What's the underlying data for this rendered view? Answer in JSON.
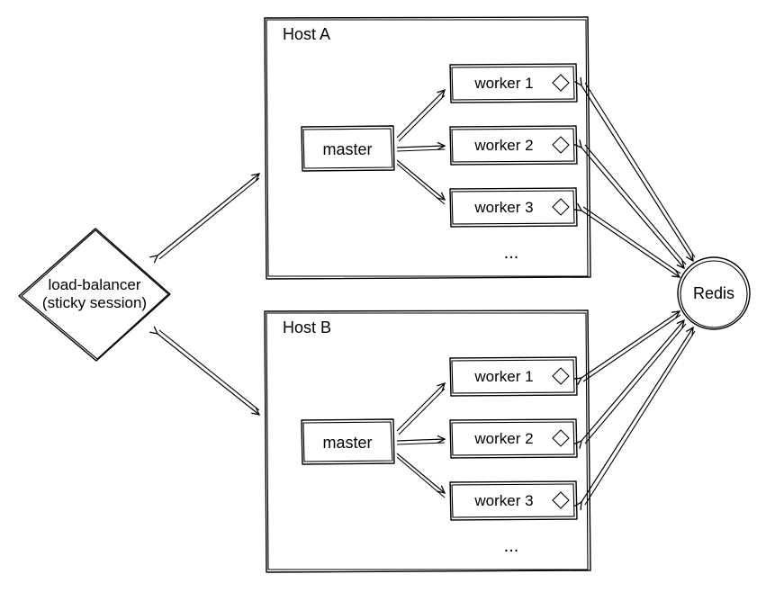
{
  "lb": {
    "line1": "load-balancer",
    "line2": "(sticky session)"
  },
  "hostA": {
    "title": "Host A",
    "master": "master",
    "workers": [
      "worker 1",
      "worker 2",
      "worker 3"
    ],
    "ellipsis": "..."
  },
  "hostB": {
    "title": "Host B",
    "master": "master",
    "workers": [
      "worker 1",
      "worker 2",
      "worker 3"
    ],
    "ellipsis": "..."
  },
  "redis": "Redis",
  "chart_data": {
    "type": "diagram",
    "title": "",
    "nodes": [
      {
        "id": "lb",
        "label": "load-balancer (sticky session)",
        "shape": "diamond"
      },
      {
        "id": "hostA",
        "label": "Host A",
        "shape": "container",
        "children": [
          {
            "id": "masterA",
            "label": "master",
            "shape": "box"
          },
          {
            "id": "wA1",
            "label": "worker 1",
            "shape": "box"
          },
          {
            "id": "wA2",
            "label": "worker 2",
            "shape": "box"
          },
          {
            "id": "wA3",
            "label": "worker 3",
            "shape": "box"
          }
        ]
      },
      {
        "id": "hostB",
        "label": "Host B",
        "shape": "container",
        "children": [
          {
            "id": "masterB",
            "label": "master",
            "shape": "box"
          },
          {
            "id": "wB1",
            "label": "worker 1",
            "shape": "box"
          },
          {
            "id": "wB2",
            "label": "worker 2",
            "shape": "box"
          },
          {
            "id": "wB3",
            "label": "worker 3",
            "shape": "box"
          }
        ]
      },
      {
        "id": "redis",
        "label": "Redis",
        "shape": "circle"
      }
    ],
    "edges": [
      {
        "from": "lb",
        "to": "hostA",
        "bidir": true
      },
      {
        "from": "lb",
        "to": "hostB",
        "bidir": true
      },
      {
        "from": "masterA",
        "to": "wA1",
        "bidir": false
      },
      {
        "from": "masterA",
        "to": "wA2",
        "bidir": false
      },
      {
        "from": "masterA",
        "to": "wA3",
        "bidir": false
      },
      {
        "from": "masterB",
        "to": "wB1",
        "bidir": false
      },
      {
        "from": "masterB",
        "to": "wB2",
        "bidir": false
      },
      {
        "from": "masterB",
        "to": "wB3",
        "bidir": false
      },
      {
        "from": "wA1",
        "to": "redis",
        "bidir": true
      },
      {
        "from": "wA2",
        "to": "redis",
        "bidir": true
      },
      {
        "from": "wA3",
        "to": "redis",
        "bidir": true
      },
      {
        "from": "wB1",
        "to": "redis",
        "bidir": true
      },
      {
        "from": "wB2",
        "to": "redis",
        "bidir": true
      },
      {
        "from": "wB3",
        "to": "redis",
        "bidir": true
      }
    ]
  }
}
